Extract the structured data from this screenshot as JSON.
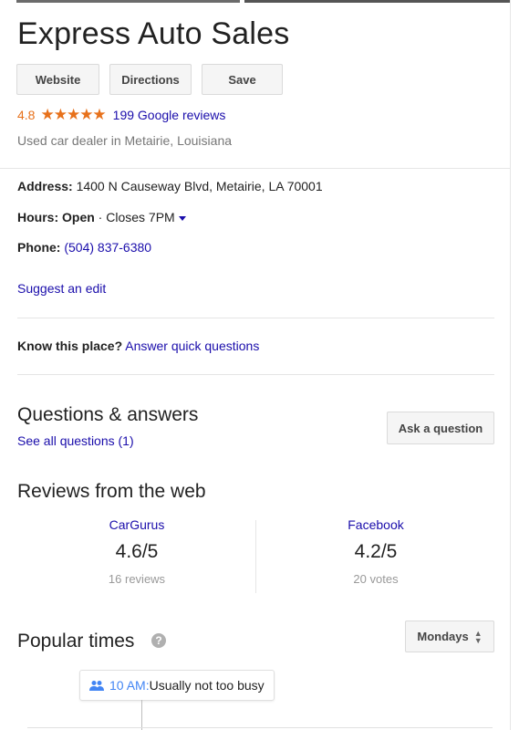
{
  "business": {
    "name": "Express Auto Sales",
    "rating": "4.8",
    "stars": "★★★★★",
    "reviews_link": "199 Google reviews",
    "category": "Used car dealer in Metairie, Louisiana"
  },
  "actions": {
    "website": "Website",
    "directions": "Directions",
    "save": "Save"
  },
  "info": {
    "address_label": "Address:",
    "address_value": "1400 N Causeway Blvd, Metairie, LA 70001",
    "hours_label": "Hours:",
    "hours_status": "Open",
    "hours_sep": " · ",
    "hours_value": "Closes 7PM",
    "phone_label": "Phone:",
    "phone_value": "(504) 837-6380",
    "suggest_edit": "Suggest an edit"
  },
  "know": {
    "label": "Know this place?",
    "link": "Answer quick questions"
  },
  "qa": {
    "title": "Questions & answers",
    "see_all": "See all questions (1)",
    "ask_button": "Ask a question"
  },
  "web_reviews": {
    "title": "Reviews from the web",
    "sources": [
      {
        "name": "CarGurus",
        "score": "4.6/5",
        "count": "16 reviews"
      },
      {
        "name": "Facebook",
        "score": "4.2/5",
        "count": "20 votes"
      }
    ]
  },
  "popular_times": {
    "title": "Popular times",
    "help_icon": "?",
    "day_selector": "Mondays",
    "tip_time": "10 AM:",
    "tip_desc": " Usually not too busy"
  },
  "colors": {
    "accent_orange": "#e7711b",
    "link_blue": "#1a0dab",
    "people_blue": "#4285f4"
  }
}
